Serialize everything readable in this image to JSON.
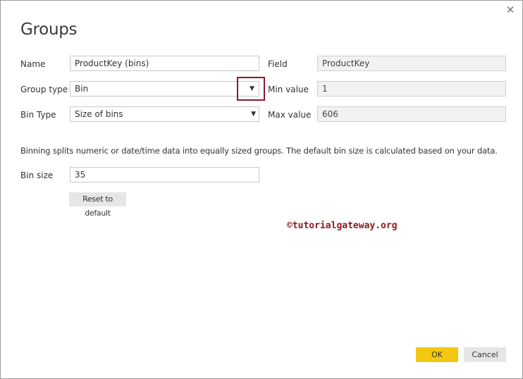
{
  "dialog": {
    "title": "Groups",
    "close_icon": "close-icon",
    "close_glyph": "✕"
  },
  "form": {
    "name_label": "Name",
    "name_value": "ProductKey (bins)",
    "group_type_label": "Group type",
    "group_type_value": "Bin",
    "bin_type_label": "Bin Type",
    "bin_type_value": "Size of bins",
    "field_label": "Field",
    "field_value": "ProductKey",
    "min_value_label": "Min value",
    "min_value": "1",
    "max_value_label": "Max value",
    "max_value": "606",
    "dropdown_arrow_glyph": "▼",
    "dropdown_icon": "chevron-down-icon"
  },
  "info": {
    "text": "Binning splits numeric or date/time data into equally sized groups. The default bin size is calculated based on your data."
  },
  "bin_size": {
    "label": "Bin size",
    "value": "35",
    "reset_label": "Reset to default"
  },
  "watermark": {
    "text": "©tutorialgateway.org"
  },
  "buttons": {
    "ok_label": "OK",
    "cancel_label": "Cancel"
  },
  "colors": {
    "accent_ok": "#f2c811",
    "highlight_border": "#8b1a2b",
    "watermark": "#8b1a1a"
  }
}
